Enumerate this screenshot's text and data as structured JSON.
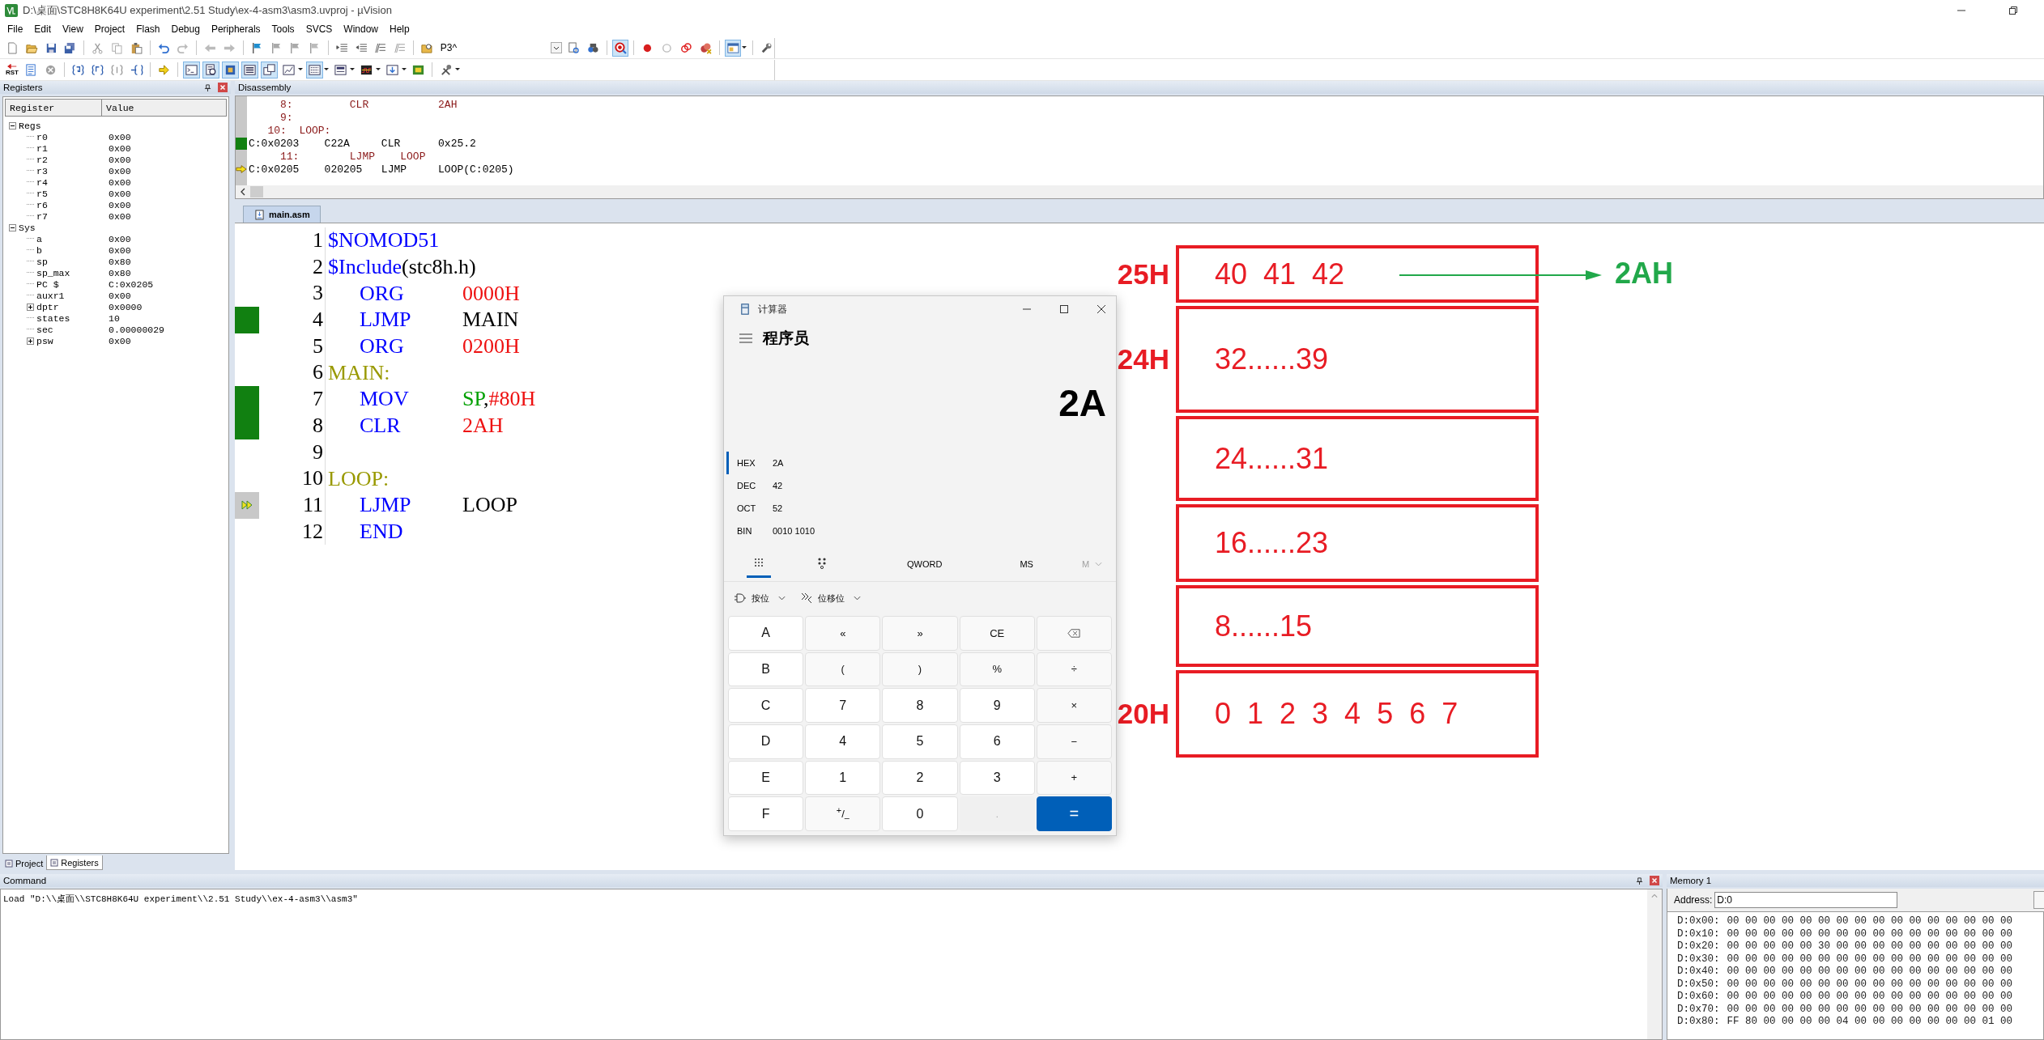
{
  "window": {
    "title": "D:\\桌面\\STC8H8K64U experiment\\2.51 Study\\ex-4-asm3\\asm3.uvproj - µVision"
  },
  "menu": [
    "File",
    "Edit",
    "View",
    "Project",
    "Flash",
    "Debug",
    "Peripherals",
    "Tools",
    "SVCS",
    "Window",
    "Help"
  ],
  "toolbar_1": [
    {
      "kind": "new",
      "pressed": false
    },
    {
      "kind": "open",
      "pressed": false
    },
    {
      "kind": "save",
      "pressed": false
    },
    {
      "kind": "saveall",
      "pressed": false
    },
    {
      "kind": "separator"
    },
    {
      "kind": "cut",
      "pressed": false
    },
    {
      "kind": "copy",
      "pressed": false
    },
    {
      "kind": "paste",
      "pressed": false
    },
    {
      "kind": "separator"
    },
    {
      "kind": "undo",
      "pressed": false
    },
    {
      "kind": "redo",
      "pressed": false
    },
    {
      "kind": "separator"
    },
    {
      "kind": "back",
      "pressed": false
    },
    {
      "kind": "forward",
      "pressed": false
    },
    {
      "kind": "separator"
    },
    {
      "kind": "flag",
      "pressed": false
    },
    {
      "kind": "flagprev",
      "pressed": false
    },
    {
      "kind": "flagnext",
      "pressed": false
    },
    {
      "kind": "flagclear",
      "pressed": false
    },
    {
      "kind": "separator"
    },
    {
      "kind": "indent",
      "pressed": false
    },
    {
      "kind": "outdent",
      "pressed": false
    },
    {
      "kind": "comment",
      "pressed": false
    },
    {
      "kind": "uncomment",
      "pressed": false
    },
    {
      "kind": "separator"
    },
    {
      "kind": "findfiles",
      "pressed": false
    },
    {
      "kind": "combo",
      "value": "P3^"
    },
    {
      "kind": "find",
      "pressed": false
    },
    {
      "kind": "incfind",
      "pressed": false
    },
    {
      "kind": "separator"
    },
    {
      "kind": "debug",
      "pressed": true
    },
    {
      "kind": "separator"
    },
    {
      "kind": "breakpoint",
      "pressed": false
    },
    {
      "kind": "bpdisable",
      "pressed": false
    },
    {
      "kind": "bpdisableall",
      "pressed": false
    },
    {
      "kind": "bpkill",
      "pressed": false
    },
    {
      "kind": "separator"
    },
    {
      "kind": "windows",
      "pressed": true
    },
    {
      "kind": "separator"
    },
    {
      "kind": "configure",
      "pressed": false
    }
  ],
  "toolbar_2": [
    {
      "kind": "reset",
      "label": "RST",
      "pressed": false
    },
    {
      "kind": "run",
      "pressed": false
    },
    {
      "kind": "stop",
      "pressed": false
    },
    {
      "kind": "separator"
    },
    {
      "kind": "stepinto",
      "pressed": false
    },
    {
      "kind": "stepover",
      "pressed": false
    },
    {
      "kind": "stepout",
      "pressed": false
    },
    {
      "kind": "runcursor",
      "pressed": false
    },
    {
      "kind": "separator"
    },
    {
      "kind": "showpc",
      "pressed": false
    },
    {
      "kind": "separator"
    },
    {
      "kind": "command",
      "pressed": true
    },
    {
      "kind": "disasm",
      "pressed": true
    },
    {
      "kind": "symbols",
      "pressed": true
    },
    {
      "kind": "registers",
      "pressed": true
    },
    {
      "kind": "callstack",
      "pressed": true
    },
    {
      "kind": "watch",
      "pressed": false
    },
    {
      "kind": "memory",
      "pressed": true
    },
    {
      "kind": "serial",
      "pressed": false
    },
    {
      "kind": "analysis",
      "pressed": false
    },
    {
      "kind": "trace",
      "pressed": false
    },
    {
      "kind": "sysview",
      "pressed": false
    },
    {
      "kind": "separator"
    },
    {
      "kind": "toolbox",
      "pressed": false
    }
  ],
  "registers_panel": {
    "title": "Registers",
    "columns": [
      "Register",
      "Value"
    ],
    "tree": [
      {
        "name": "Regs",
        "expanded": true,
        "children": [
          {
            "kind": "leaf",
            "name": "r0",
            "value": "0x00"
          },
          {
            "kind": "leaf",
            "name": "r1",
            "value": "0x00"
          },
          {
            "kind": "leaf",
            "name": "r2",
            "value": "0x00"
          },
          {
            "kind": "leaf",
            "name": "r3",
            "value": "0x00"
          },
          {
            "kind": "leaf",
            "name": "r4",
            "value": "0x00"
          },
          {
            "kind": "leaf",
            "name": "r5",
            "value": "0x00"
          },
          {
            "kind": "leaf",
            "name": "r6",
            "value": "0x00"
          },
          {
            "kind": "leaf",
            "name": "r7",
            "value": "0x00"
          }
        ]
      },
      {
        "name": "Sys",
        "expanded": true,
        "children": [
          {
            "kind": "leaf",
            "name": "a",
            "value": "0x00"
          },
          {
            "kind": "leaf",
            "name": "b",
            "value": "0x00"
          },
          {
            "kind": "leaf",
            "name": "sp",
            "value": "0x80"
          },
          {
            "kind": "leaf",
            "name": "sp_max",
            "value": "0x80"
          },
          {
            "kind": "leaf",
            "name": "PC  $",
            "value": "C:0x0205"
          },
          {
            "kind": "leaf",
            "name": "auxr1",
            "value": "0x00"
          },
          {
            "kind": "node",
            "name": "dptr",
            "value": "0x0000",
            "expanded": false
          },
          {
            "kind": "leaf",
            "name": "states",
            "value": "10"
          },
          {
            "kind": "leaf",
            "name": "sec",
            "value": "0.00000029"
          },
          {
            "kind": "node",
            "name": "psw",
            "value": "0x00",
            "expanded": false
          }
        ]
      }
    ],
    "tabs": [
      {
        "label": "Project",
        "selected": false
      },
      {
        "label": "Registers",
        "selected": true
      }
    ]
  },
  "disassembly": {
    "title": "Disassembly",
    "lines": [
      {
        "kind": "source",
        "text": "     8:         CLR           2AH",
        "executed": false,
        "current": false
      },
      {
        "kind": "source",
        "text": "     9:",
        "executed": false,
        "current": false
      },
      {
        "kind": "source",
        "text": "   10:  LOOP:",
        "executed": false,
        "current": false
      },
      {
        "kind": "code",
        "text": "C:0x0203    C22A     CLR      0x25.2",
        "executed": true,
        "current": false
      },
      {
        "kind": "source",
        "text": "     11:        LJMP    LOOP",
        "executed": false,
        "current": false
      },
      {
        "kind": "code",
        "text": "C:0x0205    020205   LJMP     LOOP(C:0205)",
        "executed": false,
        "current": true
      }
    ]
  },
  "editor": {
    "tab": "main.asm",
    "lines": [
      {
        "number": "1",
        "kind": "directive",
        "tokens": [
          {
            "kind": "keyword",
            "text": "$NOMOD51"
          }
        ],
        "executed": false,
        "current": false
      },
      {
        "number": "2",
        "kind": "directive",
        "tokens": [
          {
            "kind": "keyword",
            "text": "$Include"
          },
          {
            "kind": "plain",
            "text": "(stc8h.h)"
          }
        ],
        "executed": false,
        "current": false
      },
      {
        "number": "3",
        "kind": "instruction",
        "mnemonic": "ORG",
        "operands": [
          {
            "kind": "number",
            "text": "0000H"
          }
        ],
        "executed": false,
        "current": false
      },
      {
        "number": "4",
        "kind": "instruction",
        "mnemonic": "LJMP",
        "operands": [
          {
            "kind": "plain",
            "text": "MAIN"
          }
        ],
        "executed": true,
        "current": false
      },
      {
        "number": "5",
        "kind": "instruction",
        "mnemonic": "ORG",
        "operands": [
          {
            "kind": "number",
            "text": "0200H"
          }
        ],
        "executed": false,
        "current": false
      },
      {
        "number": "6",
        "kind": "directive",
        "tokens": [
          {
            "kind": "label",
            "text": "MAIN:"
          }
        ],
        "executed": false,
        "current": false
      },
      {
        "number": "7",
        "kind": "instruction",
        "mnemonic": "MOV",
        "operands": [
          {
            "kind": "register",
            "text": "SP"
          },
          {
            "kind": "plain",
            "text": ","
          },
          {
            "kind": "number",
            "text": "#80H"
          }
        ],
        "executed": true,
        "current": false
      },
      {
        "number": "8",
        "kind": "instruction",
        "mnemonic": "CLR",
        "operands": [
          {
            "kind": "number",
            "text": "2AH"
          }
        ],
        "executed": true,
        "current": false
      },
      {
        "number": "9",
        "kind": "blank",
        "executed": false,
        "current": false
      },
      {
        "number": "10",
        "kind": "directive",
        "tokens": [
          {
            "kind": "label",
            "text": "LOOP:"
          }
        ],
        "executed": false,
        "current": false
      },
      {
        "number": "11",
        "kind": "instruction",
        "mnemonic": "LJMP",
        "operands": [
          {
            "kind": "plain",
            "text": "LOOP"
          }
        ],
        "executed": false,
        "current": true
      },
      {
        "number": "12",
        "kind": "instruction",
        "mnemonic": "END",
        "executed": false,
        "current": false
      }
    ],
    "annotation": {
      "rows": [
        {
          "address": "25H",
          "content": "40  41  42"
        },
        {
          "address": "24H",
          "content": "32......39"
        },
        {
          "content": "24......31"
        },
        {
          "content": "16......23"
        },
        {
          "content": "8......15"
        },
        {
          "address": "20H",
          "content": "0  1  2  3  4  5  6  7"
        }
      ],
      "arrow_label": "2AH"
    }
  },
  "calculator": {
    "title": "计算器",
    "mode": "程序员",
    "display": "2A",
    "radix": [
      {
        "label": "HEX",
        "value": "2A",
        "selected": true
      },
      {
        "label": "DEC",
        "value": "42",
        "selected": false
      },
      {
        "label": "OCT",
        "value": "52",
        "selected": false
      },
      {
        "label": "BIN",
        "value": "0010 1010",
        "selected": false
      }
    ],
    "views": [
      {
        "kind": "keypad",
        "selected": true
      },
      {
        "kind": "bits",
        "selected": false
      }
    ],
    "word_size": "QWORD",
    "memory_buttons": [
      {
        "label": "MS",
        "disabled": false
      },
      {
        "label": "M",
        "disabled": true
      }
    ],
    "dropdowns": [
      {
        "kind": "bitwise",
        "label": "按位"
      },
      {
        "kind": "shift",
        "label": "位移位"
      }
    ],
    "keys": [
      {
        "kind": "digit",
        "label": "A"
      },
      {
        "kind": "op",
        "label": "«"
      },
      {
        "kind": "op",
        "label": "»"
      },
      {
        "kind": "op",
        "label": "CE"
      },
      {
        "kind": "backspace"
      },
      {
        "kind": "digit",
        "label": "B"
      },
      {
        "kind": "op",
        "label": "("
      },
      {
        "kind": "op",
        "label": ")"
      },
      {
        "kind": "op",
        "label": "%"
      },
      {
        "kind": "op",
        "label": "÷"
      },
      {
        "kind": "digit",
        "label": "C"
      },
      {
        "kind": "digit",
        "label": "7"
      },
      {
        "kind": "digit",
        "label": "8"
      },
      {
        "kind": "digit",
        "label": "9"
      },
      {
        "kind": "op",
        "label": "×"
      },
      {
        "kind": "digit",
        "label": "D"
      },
      {
        "kind": "digit",
        "label": "4"
      },
      {
        "kind": "digit",
        "label": "5"
      },
      {
        "kind": "digit",
        "label": "6"
      },
      {
        "kind": "op",
        "label": "−"
      },
      {
        "kind": "digit",
        "label": "E"
      },
      {
        "kind": "digit",
        "label": "1"
      },
      {
        "kind": "digit",
        "label": "2"
      },
      {
        "kind": "digit",
        "label": "3"
      },
      {
        "kind": "op",
        "label": "+"
      },
      {
        "kind": "digit",
        "label": "F"
      },
      {
        "kind": "op",
        "label": "$^{+}$/$_{–}$"
      },
      {
        "kind": "digit",
        "label": "0"
      },
      {
        "kind": "disabled",
        "label": "."
      },
      {
        "kind": "equals",
        "label": "="
      }
    ]
  },
  "command_panel": {
    "title": "Command",
    "text": "Load \"D:\\\\桌面\\\\STC8H8K64U experiment\\\\2.51 Study\\\\ex-4-asm3\\\\asm3\""
  },
  "memory_panel": {
    "title": "Memory 1",
    "address_label": "Address:",
    "address": "D:0",
    "rows": [
      {
        "address": "D:0x00:",
        "bytes": "00 00 00 00 00 00 00 00 00 00 00 00 00 00 00 00"
      },
      {
        "address": "D:0x10:",
        "bytes": "00 00 00 00 00 00 00 00 00 00 00 00 00 00 00 00"
      },
      {
        "address": "D:0x20:",
        "bytes": "00 00 00 00 00 30 00 00 00 00 00 00 00 00 00 00"
      },
      {
        "address": "D:0x30:",
        "bytes": "00 00 00 00 00 00 00 00 00 00 00 00 00 00 00 00"
      },
      {
        "address": "D:0x40:",
        "bytes": "00 00 00 00 00 00 00 00 00 00 00 00 00 00 00 00"
      },
      {
        "address": "D:0x50:",
        "bytes": "00 00 00 00 00 00 00 00 00 00 00 00 00 00 00 00"
      },
      {
        "address": "D:0x60:",
        "bytes": "00 00 00 00 00 00 00 00 00 00 00 00 00 00 00 00"
      },
      {
        "address": "D:0x70:",
        "bytes": "00 00 00 00 00 00 00 00 00 00 00 00 00 00 00 00"
      },
      {
        "address": "D:0x80:",
        "bytes": "FF 80 00 00 00 00 04 00 00 00 00 00 00 00 01 00"
      }
    ]
  }
}
